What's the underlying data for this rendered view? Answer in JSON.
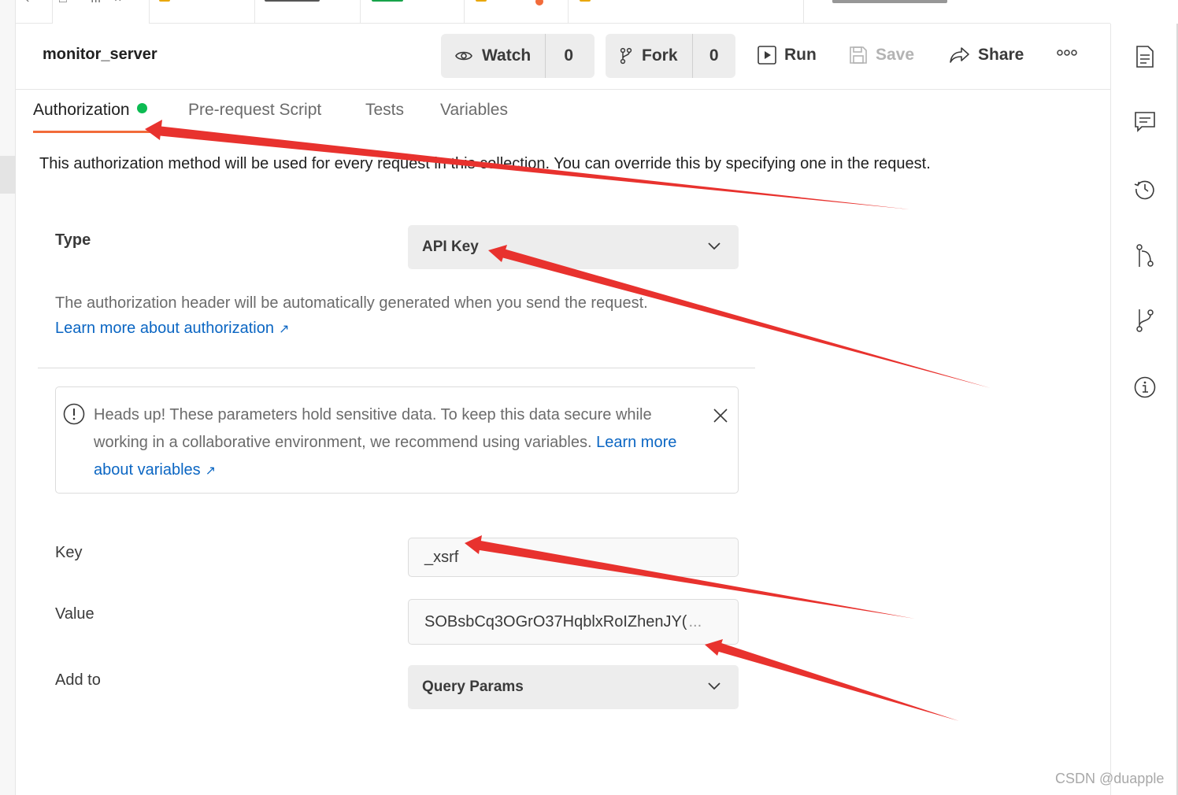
{
  "header": {
    "title": "monitor_server",
    "watch_label": "Watch",
    "watch_count": "0",
    "fork_label": "Fork",
    "fork_count": "0",
    "run_label": "Run",
    "save_label": "Save",
    "share_label": "Share"
  },
  "tabs": [
    {
      "label": "Authorization"
    },
    {
      "label": "Pre-request Script"
    },
    {
      "label": "Tests"
    },
    {
      "label": "Variables"
    }
  ],
  "auth": {
    "description": "This authorization method will be used for every request in this collection. You can override this by specifying one in the request.",
    "type_label": "Type",
    "type_value": "API Key",
    "helper": "The authorization header will be automatically generated when you send the request.",
    "learn_auth": "Learn more about authorization",
    "warning_text": "Heads up! These parameters hold sensitive data. To keep this data secure while working in a collaborative environment, we recommend using variables.",
    "warning_link": "Learn more about variables",
    "key_label": "Key",
    "key_value": "_xsrf",
    "value_label": "Value",
    "value_value": "SOBsbCq3OGrO37HqblxRoIZhenJY(",
    "value_ellipsis": "...",
    "addto_label": "Add to",
    "addto_value": "Query Params"
  },
  "watermark": "CSDN @duapple",
  "colors": {
    "accent": "#f26b3a",
    "link": "#0b66c3",
    "active_dot": "#0cbb52",
    "annotation": "#e8322e"
  }
}
